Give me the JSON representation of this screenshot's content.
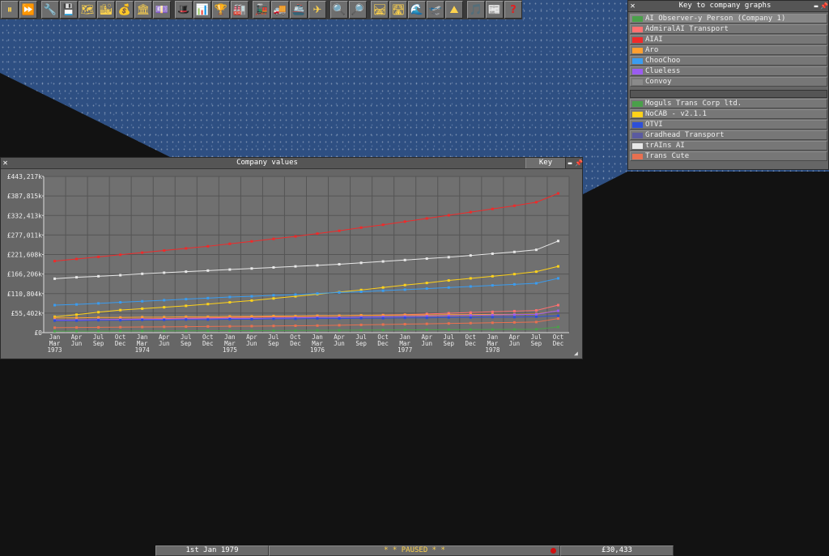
{
  "toolbar": {
    "buttons": [
      {
        "name": "pause-button",
        "glyph": "⏸"
      },
      {
        "name": "fast-forward-button",
        "glyph": "⏩"
      },
      {
        "name": "settings-button",
        "glyph": "🔧"
      },
      {
        "name": "save-button",
        "glyph": "💾"
      },
      {
        "name": "map-button",
        "glyph": "🗺"
      },
      {
        "name": "town-directory-button",
        "glyph": "🏙"
      },
      {
        "name": "subsidies-button",
        "glyph": "💰"
      },
      {
        "name": "station-list-button",
        "glyph": "🏛"
      },
      {
        "name": "finances-button",
        "glyph": "💷"
      },
      {
        "name": "company-button",
        "glyph": "🎩"
      },
      {
        "name": "graphs-button",
        "glyph": "📊"
      },
      {
        "name": "league-table-button",
        "glyph": "🏆"
      },
      {
        "name": "industry-button",
        "glyph": "🏭"
      },
      {
        "name": "train-list-button",
        "glyph": "🚂"
      },
      {
        "name": "road-vehicle-list-button",
        "glyph": "🚚"
      },
      {
        "name": "ship-list-button",
        "glyph": "🚢"
      },
      {
        "name": "aircraft-list-button",
        "glyph": "✈"
      },
      {
        "name": "zoom-in-button",
        "glyph": "🔍"
      },
      {
        "name": "zoom-out-button",
        "glyph": "🔎"
      },
      {
        "name": "build-railway-button",
        "glyph": "🛤"
      },
      {
        "name": "build-road-button",
        "glyph": "🛣"
      },
      {
        "name": "build-waterways-button",
        "glyph": "🌊"
      },
      {
        "name": "build-airport-button",
        "glyph": "🛫"
      },
      {
        "name": "landscaping-button",
        "glyph": "⛰"
      },
      {
        "name": "music-button",
        "glyph": "🎵"
      },
      {
        "name": "news-button",
        "glyph": "📰"
      },
      {
        "name": "help-button",
        "glyph": "?"
      }
    ]
  },
  "graph_window": {
    "title": "Company values",
    "key_button": "Key"
  },
  "chart_data": {
    "type": "line",
    "title": "Company values",
    "y_ticks": [
      "£443,217k",
      "£387,815k",
      "£332,413k",
      "£277,011k",
      "£221,608k",
      "£166,206k",
      "£110,804k",
      "£55,402k",
      "£0"
    ],
    "x_month_labels": [
      "Jan",
      "Apr",
      "Jul",
      "Oct",
      "Jan",
      "Apr",
      "Jul",
      "Oct",
      "Jan",
      "Apr",
      "Jul",
      "Oct",
      "Jan",
      "Apr",
      "Jul",
      "Oct",
      "Jan",
      "Apr",
      "Jul",
      "Oct",
      "Jan",
      "Apr",
      "Jul",
      "Oct"
    ],
    "x_month_labels_lower": [
      "Mar",
      "Jun",
      "Sep",
      "Dec",
      "Mar",
      "Jun",
      "Sep",
      "Dec",
      "Mar",
      "Jun",
      "Sep",
      "Dec",
      "Mar",
      "Jun",
      "Sep",
      "Dec",
      "Mar",
      "Jun",
      "Sep",
      "Dec",
      "Mar",
      "Jun",
      "Sep",
      "Dec"
    ],
    "x_year_labels": [
      "1973",
      "1974",
      "1975",
      "1976",
      "1977",
      "1978"
    ],
    "ylim": [
      0,
      443217
    ],
    "points_per_series": 24,
    "grid": true,
    "series": [
      {
        "name": "AIAI",
        "color": "#ef2a2a",
        "values": [
          203000,
          209000,
          215000,
          221000,
          227000,
          233000,
          239000,
          245000,
          252000,
          259000,
          266000,
          273000,
          281000,
          289000,
          298000,
          306000,
          315000,
          324000,
          333000,
          342000,
          351000,
          360000,
          370000,
          395000
        ]
      },
      {
        "name": "trAIns AI",
        "color": "#e8e8e8",
        "values": [
          153000,
          157000,
          160000,
          163000,
          167000,
          170000,
          173000,
          176000,
          179000,
          182000,
          185000,
          188000,
          191000,
          194000,
          198000,
          202000,
          206000,
          210000,
          214000,
          219000,
          224000,
          229000,
          235000,
          260000
        ]
      },
      {
        "name": "NoCAB - v2.1.1",
        "color": "#ffd21a",
        "values": [
          45000,
          51000,
          58000,
          64000,
          68000,
          72000,
          76000,
          81000,
          86000,
          91000,
          97000,
          103000,
          109000,
          115000,
          121000,
          128000,
          135000,
          141000,
          148000,
          154000,
          160000,
          166000,
          173000,
          188000
        ]
      },
      {
        "name": "ChooChoo",
        "color": "#3a9cf0",
        "values": [
          78000,
          80000,
          83000,
          86000,
          89000,
          92000,
          95000,
          98000,
          101000,
          103000,
          106000,
          108000,
          111000,
          114000,
          116000,
          119000,
          122000,
          125000,
          128000,
          131000,
          134000,
          137000,
          140000,
          154000
        ]
      },
      {
        "name": "AdmiralAI Transport",
        "color": "#ff7070",
        "values": [
          35000,
          36000,
          37000,
          38000,
          39000,
          40000,
          41000,
          42000,
          43000,
          44000,
          45000,
          46000,
          47000,
          48000,
          49000,
          50000,
          51000,
          53000,
          55000,
          57000,
          59000,
          61000,
          63000,
          78000
        ]
      },
      {
        "name": "Aro",
        "color": "#ff9f30",
        "values": [
          42000,
          42000,
          43000,
          43000,
          44000,
          44000,
          45000,
          45000,
          46000,
          46000,
          47000,
          47000,
          48000,
          48000,
          49000,
          49000,
          50000,
          50000,
          51000,
          51000,
          52000,
          52000,
          53000,
          62000
        ]
      },
      {
        "name": "Clueless",
        "color": "#9a5cf0",
        "values": [
          36000,
          36000,
          37000,
          37000,
          38000,
          38000,
          39000,
          39000,
          40000,
          40000,
          41000,
          42000,
          43000,
          43000,
          44000,
          45000,
          46000,
          47000,
          48000,
          49000,
          50000,
          51000,
          52000,
          62000
        ]
      },
      {
        "name": "OTVI",
        "color": "#2d4fd8",
        "values": [
          34000,
          34000,
          35000,
          35000,
          36000,
          36000,
          37000,
          37000,
          38000,
          38000,
          39000,
          39000,
          40000,
          40000,
          41000,
          41000,
          42000,
          42000,
          43000,
          43000,
          44000,
          44000,
          45000,
          48000
        ]
      },
      {
        "name": "Trans Cute",
        "color": "#e87050",
        "values": [
          14000,
          14500,
          15000,
          15500,
          16000,
          16500,
          17000,
          17500,
          18000,
          18500,
          19000,
          19500,
          20000,
          21000,
          22000,
          23000,
          24000,
          25000,
          26000,
          27000,
          28000,
          29000,
          30000,
          40000
        ]
      },
      {
        "name": "Moguls Trans Corp ltd.",
        "color": "#4aa04a",
        "values": [
          4000,
          4200,
          4400,
          4600,
          4800,
          5000,
          5200,
          5400,
          5600,
          5800,
          6000,
          6300,
          6600,
          6900,
          7200,
          7500,
          7800,
          8100,
          8400,
          8700,
          9000,
          9300,
          9600,
          16000
        ]
      }
    ]
  },
  "key_window": {
    "title": "Key to company graphs",
    "items": [
      {
        "label": "AI Observer-y Person (Company 1)",
        "color": "#4aa04a"
      },
      {
        "label": "AdmiralAI Transport",
        "color": "#ff7070"
      },
      {
        "label": "AIAI",
        "color": "#ef2a2a"
      },
      {
        "label": "Aro",
        "color": "#ff9f30"
      },
      {
        "label": "ChooChoo",
        "color": "#3a9cf0"
      },
      {
        "label": "Clueless",
        "color": "#9a5cf0"
      },
      {
        "label": "Convoy",
        "color": "#8a8a8a"
      }
    ],
    "items2": [
      {
        "label": "Moguls Trans Corp ltd.",
        "color": "#4aa04a"
      },
      {
        "label": "NoCAB - v2.1.1",
        "color": "#ffd21a"
      },
      {
        "label": "OTVI",
        "color": "#2d4fd8"
      },
      {
        "label": "Gradhead Transport",
        "color": "#5a5aa0"
      },
      {
        "label": "trAIns AI",
        "color": "#e8e8e8"
      },
      {
        "label": "Trans Cute",
        "color": "#e87050"
      }
    ]
  },
  "statusbar": {
    "date": "1st Jan 1979",
    "pause_text": "*  *  PAUSED  *  *",
    "money": "£30,433"
  },
  "colors": {
    "news_indicator": "#d01010",
    "pause_text": "#ffd34d"
  }
}
